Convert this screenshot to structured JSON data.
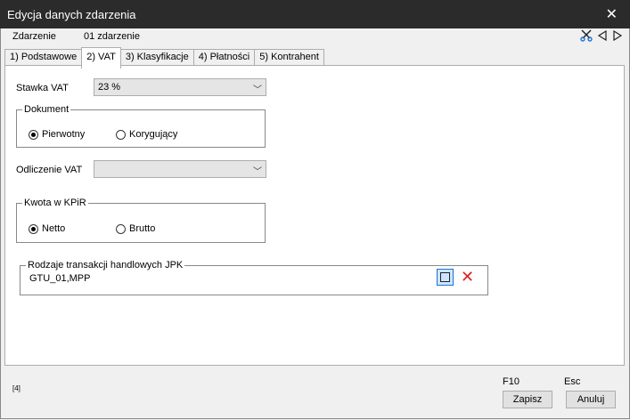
{
  "window": {
    "title": "Edycja danych zdarzenia"
  },
  "event": {
    "label": "Zdarzenie",
    "value": "01 zdarzenie"
  },
  "tabs": [
    {
      "label": "1) Podstawowe"
    },
    {
      "label": "2) VAT"
    },
    {
      "label": "3) Klasyfikacje"
    },
    {
      "label": "4) Płatności"
    },
    {
      "label": "5) Kontrahent"
    }
  ],
  "vat": {
    "rate_label": "Stawka VAT",
    "rate_value": "23 %",
    "document": {
      "legend": "Dokument",
      "option1": "Pierwotny",
      "option2": "Korygujący",
      "selected": "Pierwotny"
    },
    "deduction_label": "Odliczenie VAT",
    "deduction_value": "",
    "kpir": {
      "legend": "Kwota w KPiR",
      "option1": "Netto",
      "option2": "Brutto",
      "selected": "Netto"
    },
    "jpk": {
      "legend": "Rodzaje transakcji handlowych JPK",
      "value": "GTU_01,MPP"
    }
  },
  "footer": {
    "code": "[4]",
    "save_key": "F10",
    "cancel_key": "Esc",
    "save_label": "Zapisz",
    "cancel_label": "Anuluj"
  }
}
